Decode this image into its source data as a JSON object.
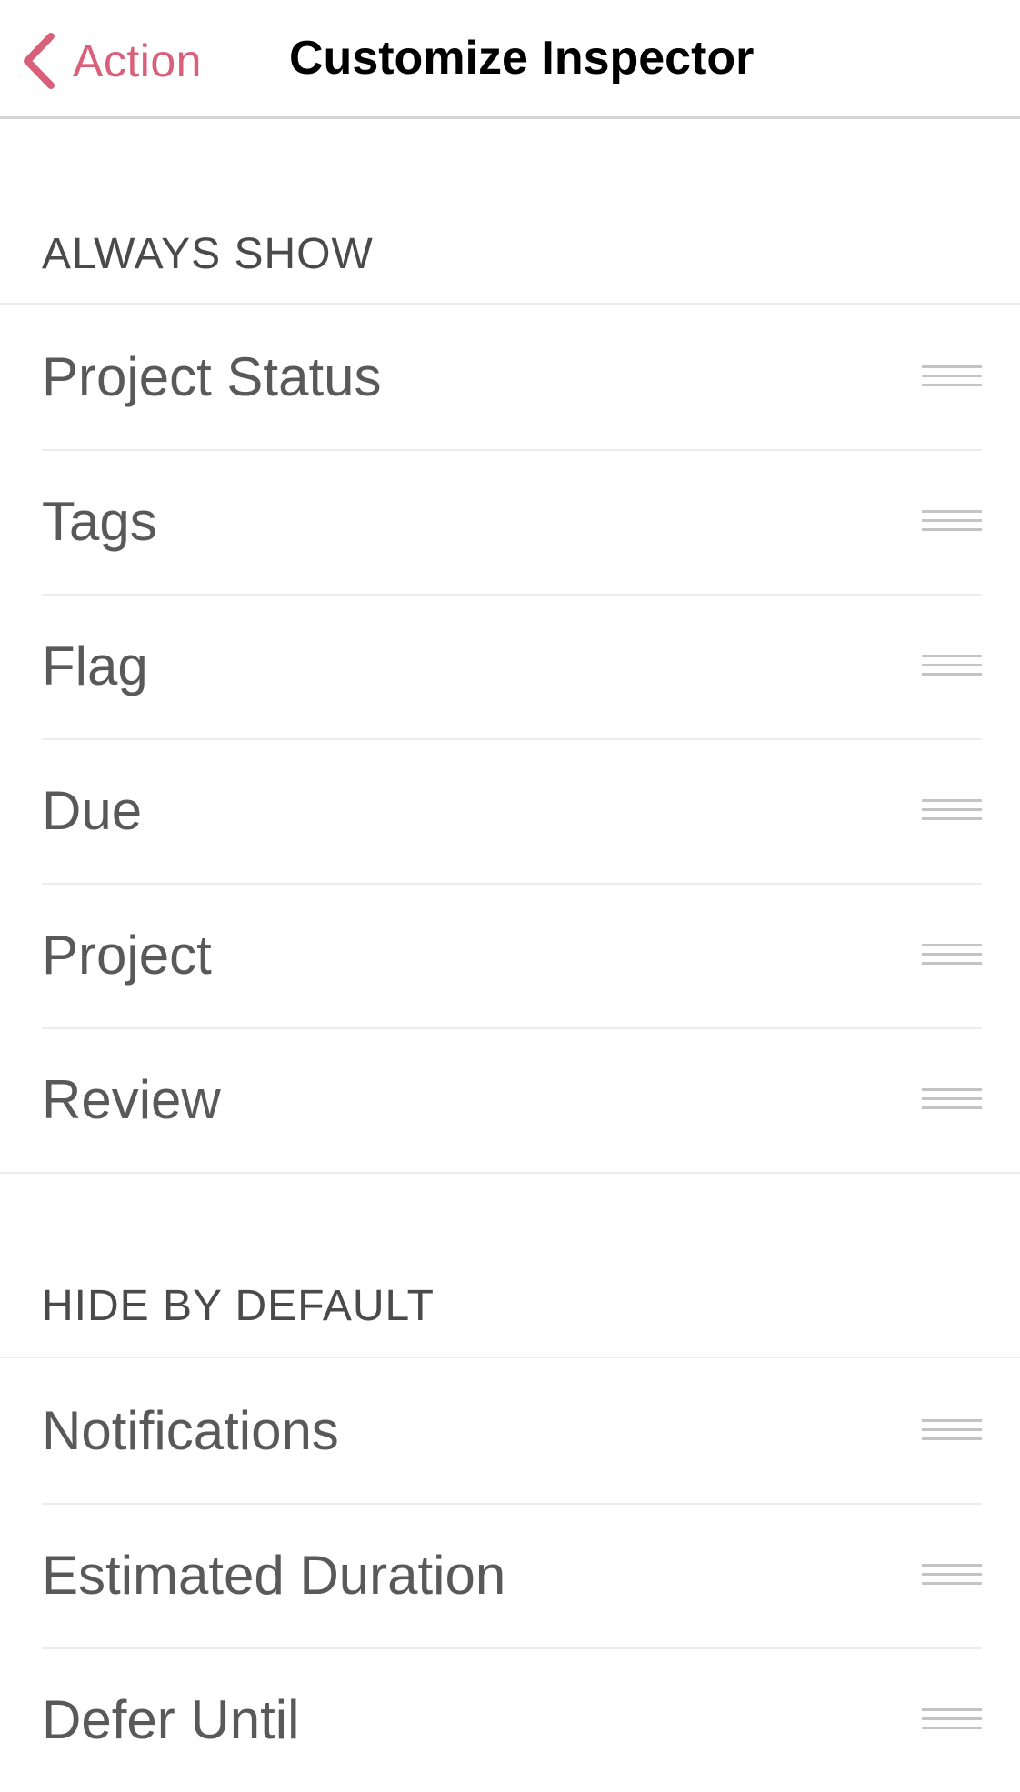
{
  "nav": {
    "back_label": "Action",
    "back_icon": "chevron-left-icon",
    "title": "Customize Inspector"
  },
  "colors": {
    "accent": "#d9607a",
    "row_text": "#595959",
    "section_header_text": "#4a4a4a"
  },
  "always_show": {
    "header": "ALWAYS SHOW",
    "items": [
      {
        "label": "Project Status"
      },
      {
        "label": "Tags"
      },
      {
        "label": "Flag"
      },
      {
        "label": "Due"
      },
      {
        "label": "Project"
      },
      {
        "label": "Review"
      }
    ]
  },
  "hide_by_default": {
    "header": "HIDE BY DEFAULT",
    "items": [
      {
        "label": "Notifications"
      },
      {
        "label": "Estimated Duration"
      },
      {
        "label": "Defer Until"
      }
    ]
  }
}
